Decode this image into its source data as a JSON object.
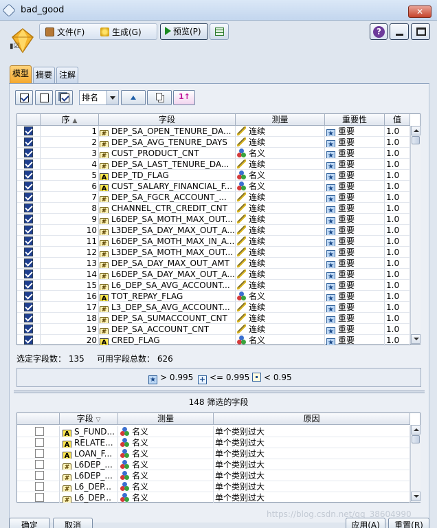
{
  "window": {
    "title": "bad_good"
  },
  "toolbar": {
    "file": "文件(F)",
    "generate": "生成(G)",
    "preview": "预览(P)",
    "help": "?"
  },
  "tabs": [
    {
      "label": "模型",
      "active": true
    },
    {
      "label": "摘要",
      "active": false
    },
    {
      "label": "注解",
      "active": false
    }
  ],
  "controls": {
    "sort_label": "排名"
  },
  "main_table": {
    "columns": [
      "序",
      "字段",
      "测量",
      "重要性",
      "值"
    ],
    "rows": [
      {
        "n": "1",
        "field": "DEP_SA_OPEN_TENURE_DA...",
        "ftype": "num",
        "measure": "连续",
        "mtype": "ruler",
        "importance": "重要",
        "value": "1.0",
        "checked": true
      },
      {
        "n": "2",
        "field": "DEP_SA_AVG_TENURE_DAYS",
        "ftype": "num",
        "measure": "连续",
        "mtype": "ruler",
        "importance": "重要",
        "value": "1.0",
        "checked": true
      },
      {
        "n": "3",
        "field": "CUST_PRODUCT_CNT",
        "ftype": "num",
        "measure": "名义",
        "mtype": "nom",
        "importance": "重要",
        "value": "1.0",
        "checked": true
      },
      {
        "n": "4",
        "field": "DEP_SA_LAST_TENURE_DA...",
        "ftype": "num",
        "measure": "连续",
        "mtype": "ruler",
        "importance": "重要",
        "value": "1.0",
        "checked": true
      },
      {
        "n": "5",
        "field": "DEP_TD_FLAG",
        "ftype": "A",
        "measure": "名义",
        "mtype": "nom",
        "importance": "重要",
        "value": "1.0",
        "checked": true
      },
      {
        "n": "6",
        "field": "CUST_SALARY_FINANCIAL_F...",
        "ftype": "A",
        "measure": "名义",
        "mtype": "nom",
        "importance": "重要",
        "value": "1.0",
        "checked": true
      },
      {
        "n": "7",
        "field": "DEP_SA_FGCR_ACCOUNT_...",
        "ftype": "num",
        "measure": "连续",
        "mtype": "ruler",
        "importance": "重要",
        "value": "1.0",
        "checked": true
      },
      {
        "n": "8",
        "field": "CHANNEL_CTR_CREDIT_CNT",
        "ftype": "num",
        "measure": "连续",
        "mtype": "ruler",
        "importance": "重要",
        "value": "1.0",
        "checked": true
      },
      {
        "n": "9",
        "field": "L6DEP_SA_MOTH_MAX_OUT...",
        "ftype": "num",
        "measure": "连续",
        "mtype": "ruler",
        "importance": "重要",
        "value": "1.0",
        "checked": true
      },
      {
        "n": "10",
        "field": "L3DEP_SA_DAY_MAX_OUT_A...",
        "ftype": "num",
        "measure": "连续",
        "mtype": "ruler",
        "importance": "重要",
        "value": "1.0",
        "checked": true
      },
      {
        "n": "11",
        "field": "L6DEP_SA_MOTH_MAX_IN_A...",
        "ftype": "num",
        "measure": "连续",
        "mtype": "ruler",
        "importance": "重要",
        "value": "1.0",
        "checked": true
      },
      {
        "n": "12",
        "field": "L3DEP_SA_MOTH_MAX_OUT...",
        "ftype": "num",
        "measure": "连续",
        "mtype": "ruler",
        "importance": "重要",
        "value": "1.0",
        "checked": true
      },
      {
        "n": "13",
        "field": "DEP_SA_DAY_MAX_OUT_AMT",
        "ftype": "num",
        "measure": "连续",
        "mtype": "ruler",
        "importance": "重要",
        "value": "1.0",
        "checked": true
      },
      {
        "n": "14",
        "field": "L6DEP_SA_DAY_MAX_OUT_A...",
        "ftype": "num",
        "measure": "连续",
        "mtype": "ruler",
        "importance": "重要",
        "value": "1.0",
        "checked": true
      },
      {
        "n": "15",
        "field": "L6_DEP_SA_AVG_ACCOUNT...",
        "ftype": "num",
        "measure": "连续",
        "mtype": "ruler",
        "importance": "重要",
        "value": "1.0",
        "checked": true
      },
      {
        "n": "16",
        "field": "TOT_REPAY_FLAG",
        "ftype": "A",
        "measure": "名义",
        "mtype": "nom",
        "importance": "重要",
        "value": "1.0",
        "checked": true
      },
      {
        "n": "17",
        "field": "L3_DEP_SA_AVG_ACCOUNT...",
        "ftype": "num",
        "measure": "连续",
        "mtype": "ruler",
        "importance": "重要",
        "value": "1.0",
        "checked": true
      },
      {
        "n": "18",
        "field": "DEP_SA_SUMACCOUNT_CNT",
        "ftype": "num",
        "measure": "连续",
        "mtype": "ruler",
        "importance": "重要",
        "value": "1.0",
        "checked": true
      },
      {
        "n": "19",
        "field": "DEP_SA_ACCOUNT_CNT",
        "ftype": "num",
        "measure": "连续",
        "mtype": "ruler",
        "importance": "重要",
        "value": "1.0",
        "checked": true
      },
      {
        "n": "20",
        "field": "CRED_FLAG",
        "ftype": "A",
        "measure": "名义",
        "mtype": "nom",
        "importance": "重要",
        "value": "1.0",
        "checked": true
      }
    ]
  },
  "status": {
    "selected": "选定字段数： 135",
    "available": "可用字段总数： 626"
  },
  "legend": [
    {
      "icon": "star",
      "text": "> 0.995"
    },
    {
      "icon": "plus",
      "text": "<= 0.995"
    },
    {
      "icon": "dot",
      "text": "< 0.95"
    }
  ],
  "filtered": {
    "title": "148 筛选的字段",
    "columns": [
      "字段",
      "测量",
      "原因"
    ],
    "rows": [
      {
        "field": "S_FUND...",
        "ftype": "A",
        "measure": "名义",
        "reason": "单个类别过大"
      },
      {
        "field": "RELATE...",
        "ftype": "A",
        "measure": "名义",
        "reason": "单个类别过大"
      },
      {
        "field": "LOAN_F...",
        "ftype": "A",
        "measure": "名义",
        "reason": "单个类别过大"
      },
      {
        "field": "L6DEP_...",
        "ftype": "num",
        "measure": "名义",
        "reason": "单个类别过大"
      },
      {
        "field": "L6DEP_...",
        "ftype": "num",
        "measure": "名义",
        "reason": "单个类别过大"
      },
      {
        "field": "L6_DEP...",
        "ftype": "num",
        "measure": "名义",
        "reason": "单个类别过大"
      },
      {
        "field": "L6_DEP...",
        "ftype": "num",
        "measure": "名义",
        "reason": "单个类别过大"
      }
    ]
  },
  "buttons": {
    "ok": "确定",
    "cancel": "取消",
    "apply": "应用(A)",
    "reset": "重置(R)"
  },
  "watermark": "https://blog.csdn.net/qq_38604990"
}
